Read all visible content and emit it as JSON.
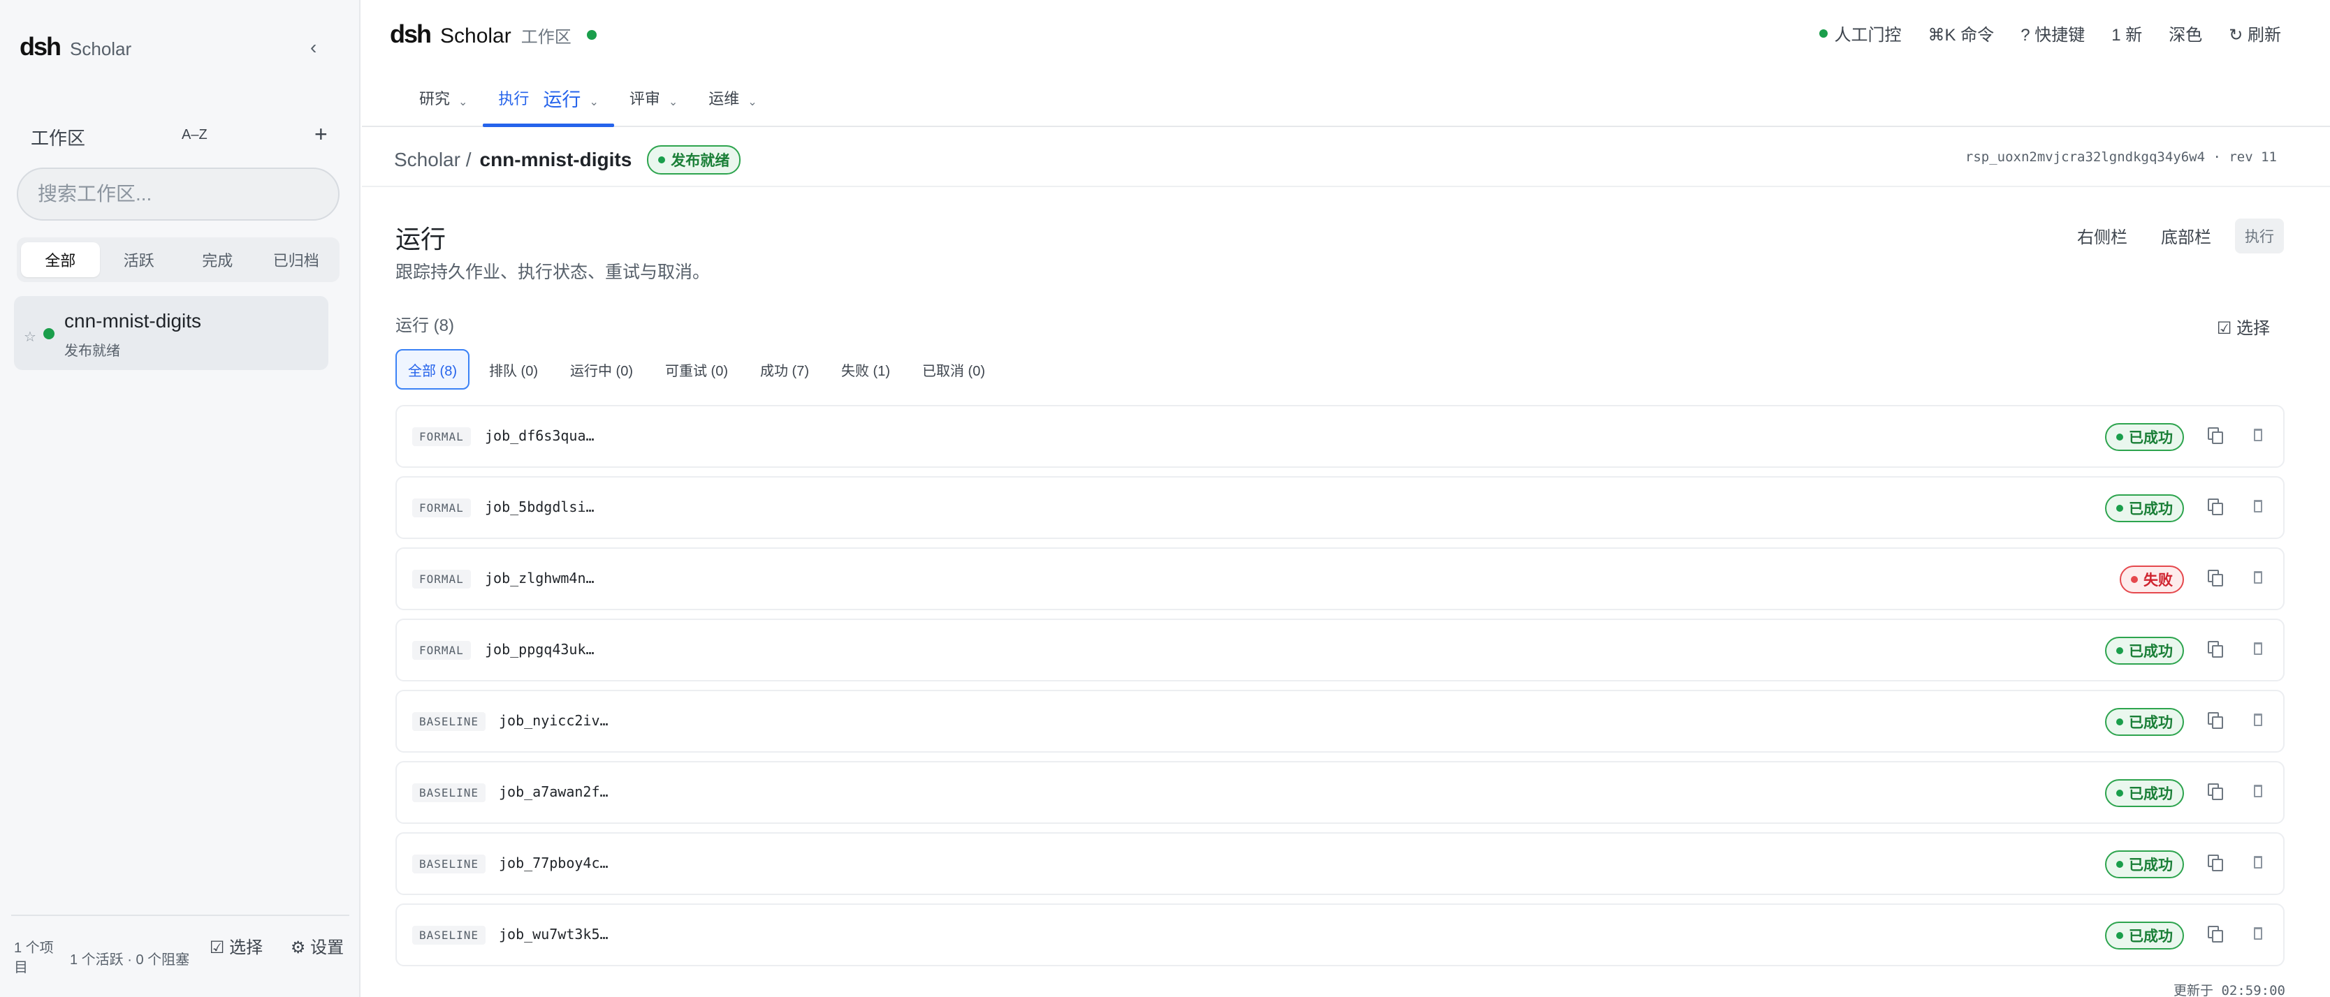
{
  "sidebar": {
    "logo": "dsh",
    "app_name": "Scholar",
    "collapse_icon": "‹",
    "workspace_title": "工作区",
    "sort_label": "A–Z",
    "add_icon": "+",
    "search_placeholder": "搜索工作区...",
    "filters": [
      "全部",
      "活跃",
      "完成",
      "已归档"
    ],
    "active_filter": "全部",
    "items": [
      {
        "star": "☆",
        "name": "cnn-mnist-digits",
        "status": "发布就绪",
        "dot_color": "#1a9e4b"
      }
    ],
    "footer": {
      "count": "1 个项目",
      "status": "1 个活跃 · 0 个阻塞",
      "select": "☑ 选择",
      "settings": "⚙ 设置"
    }
  },
  "header": {
    "logo": "dsh",
    "app_name": "Scholar",
    "workspace": "工作区",
    "actions": {
      "human_control": "人工门控",
      "command": "⌘K 命令",
      "shortcuts": "? 快捷键",
      "new": "1 新",
      "theme": "深色",
      "refresh": "↻ 刷新"
    },
    "tabs": [
      {
        "label": "研究",
        "caret": "⌄"
      },
      {
        "label": "执行",
        "sub": "运行",
        "caret": "⌄",
        "active": true
      },
      {
        "label": "评审",
        "caret": "⌄"
      },
      {
        "label": "运维",
        "caret": "⌄"
      }
    ]
  },
  "breadcrumb": {
    "root": "Scholar /",
    "current": "cnn-mnist-digits",
    "badge": "发布就绪",
    "meta": "rsp_uoxn2mvjcra32lgndkgq34y6w4 · rev 11"
  },
  "main": {
    "title": "运行",
    "subtitle": "跟踪持久作业、执行状态、重试与取消。",
    "actions": {
      "right_panel": "右侧栏",
      "bottom_panel": "底部栏",
      "execute": "执行"
    },
    "runs_label": "运行 (8)",
    "select_label": "☑ 选择",
    "filters": [
      "全部 (8)",
      "排队 (0)",
      "运行中 (0)",
      "可重试 (0)",
      "成功 (7)",
      "失败 (1)",
      "已取消 (0)"
    ],
    "active_filter": "全部 (8)",
    "runs": [
      {
        "type": "FORMAL",
        "id": "job_df6s3qua…",
        "status": "已成功",
        "state": "ok"
      },
      {
        "type": "FORMAL",
        "id": "job_5bdgdlsi…",
        "status": "已成功",
        "state": "ok"
      },
      {
        "type": "FORMAL",
        "id": "job_zlghwm4n…",
        "status": "失败",
        "state": "fail"
      },
      {
        "type": "FORMAL",
        "id": "job_ppgq43uk…",
        "status": "已成功",
        "state": "ok"
      },
      {
        "type": "BASELINE",
        "id": "job_nyicc2iv…",
        "status": "已成功",
        "state": "ok"
      },
      {
        "type": "BASELINE",
        "id": "job_a7awan2f…",
        "status": "已成功",
        "state": "ok"
      },
      {
        "type": "BASELINE",
        "id": "job_77pboy4c…",
        "status": "已成功",
        "state": "ok"
      },
      {
        "type": "BASELINE",
        "id": "job_wu7wt3k5…",
        "status": "已成功",
        "state": "ok"
      }
    ],
    "updated": "更新于 02:59:00"
  },
  "colors": {
    "accent": "#2563eb",
    "success": "#1a9e4b",
    "danger": "#e5484d"
  }
}
